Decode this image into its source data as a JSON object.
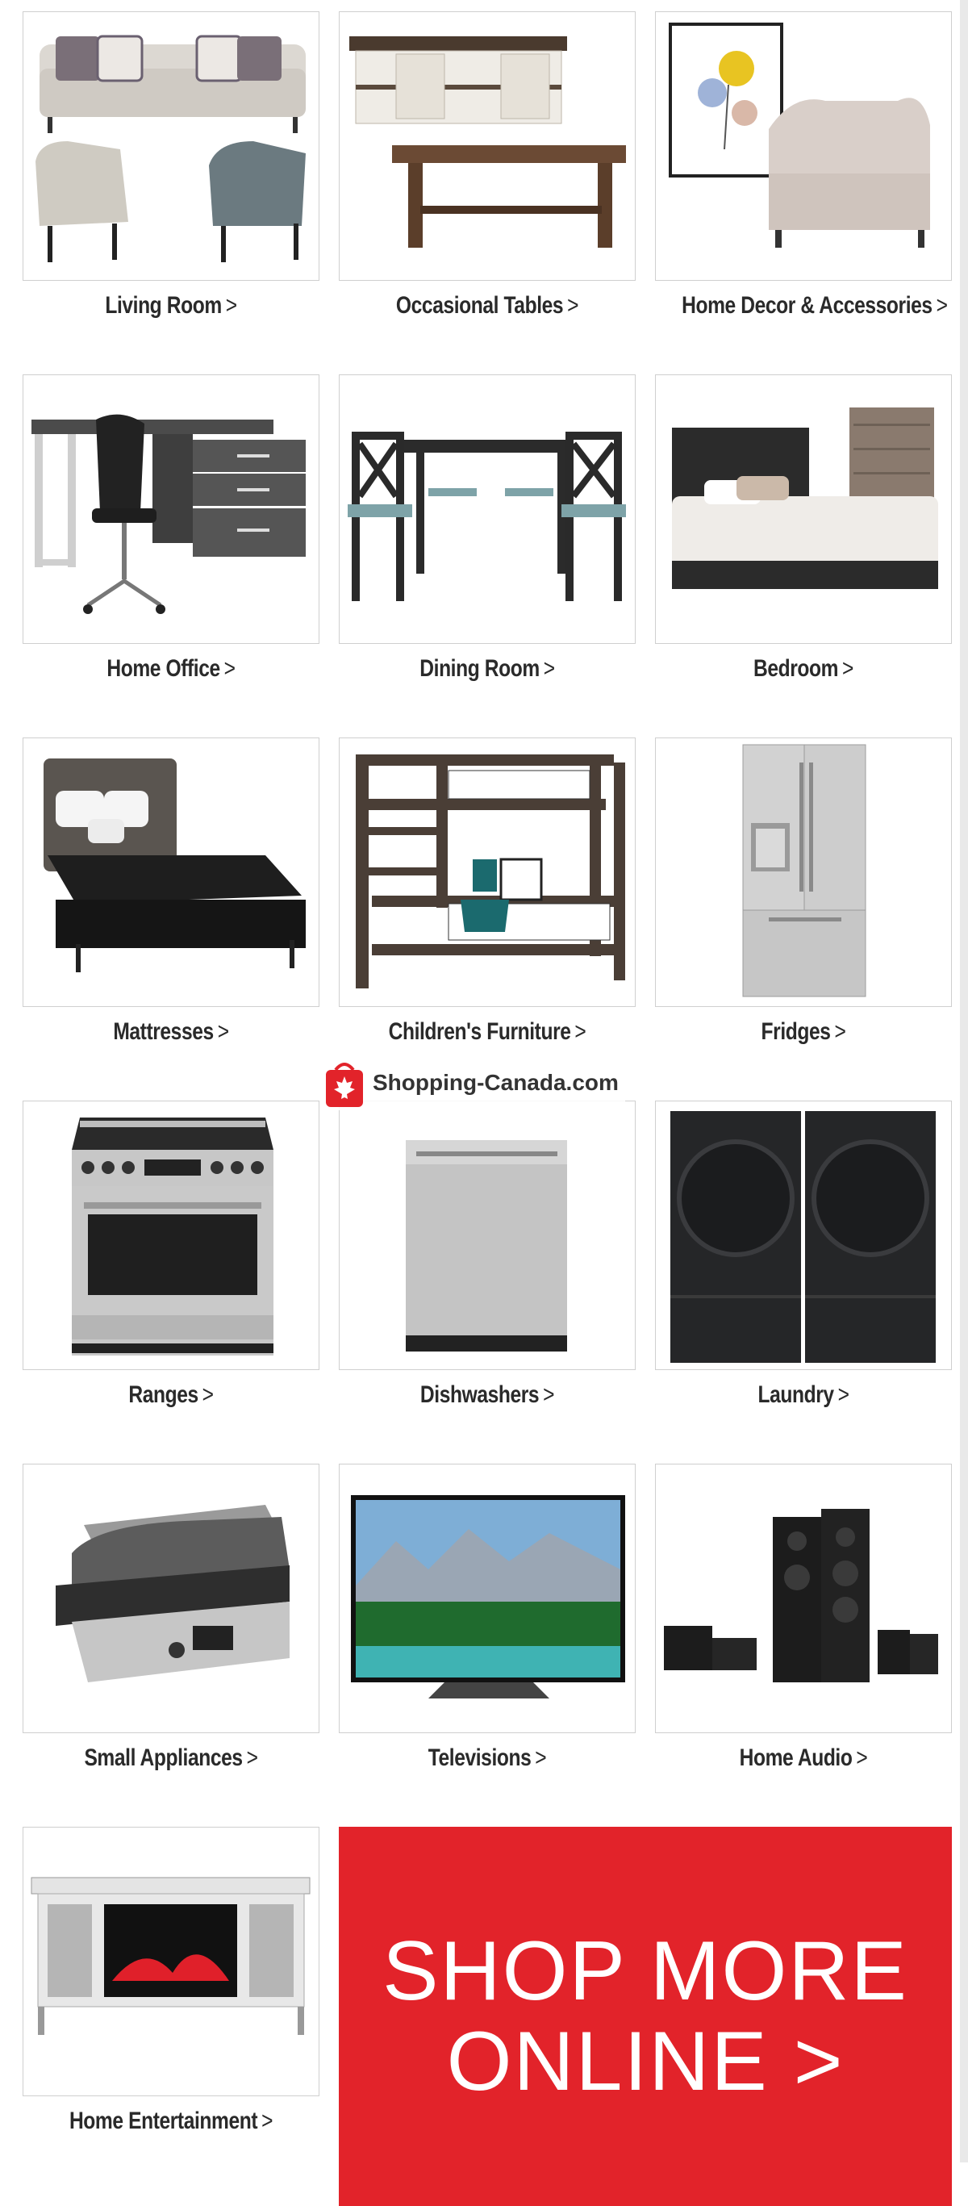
{
  "tiles": [
    {
      "label": "Living Room",
      "icon": "sofa-set"
    },
    {
      "label": "Occasional Tables",
      "icon": "coffee-tables"
    },
    {
      "label": "Home Decor & Accessories",
      "icon": "bench-and-art"
    },
    {
      "label": "Home Office",
      "icon": "desk-and-chair"
    },
    {
      "label": "Dining Room",
      "icon": "dining-set"
    },
    {
      "label": "Bedroom",
      "icon": "bed-and-dresser"
    },
    {
      "label": "Mattresses",
      "icon": "mattress"
    },
    {
      "label": "Children's Furniture",
      "icon": "bunk-bed"
    },
    {
      "label": "Fridges",
      "icon": "fridge"
    },
    {
      "label": "Ranges",
      "icon": "range"
    },
    {
      "label": "Dishwashers",
      "icon": "dishwasher"
    },
    {
      "label": "Laundry",
      "icon": "washer-dryer"
    },
    {
      "label": "Small Appliances",
      "icon": "grill"
    },
    {
      "label": "Televisions",
      "icon": "tv"
    },
    {
      "label": "Home Audio",
      "icon": "speakers"
    },
    {
      "label": "Home Entertainment",
      "icon": "fireplace-console"
    }
  ],
  "chevron": ">",
  "shop_more": {
    "line1": "SHOP MORE",
    "line2": "ONLINE",
    "chevron": ">"
  },
  "watermark": {
    "text": "Shopping-Canada.com"
  },
  "colors": {
    "brand_red": "#e2232a",
    "border": "#cfcfcf",
    "label_text": "#2a2a2a"
  }
}
